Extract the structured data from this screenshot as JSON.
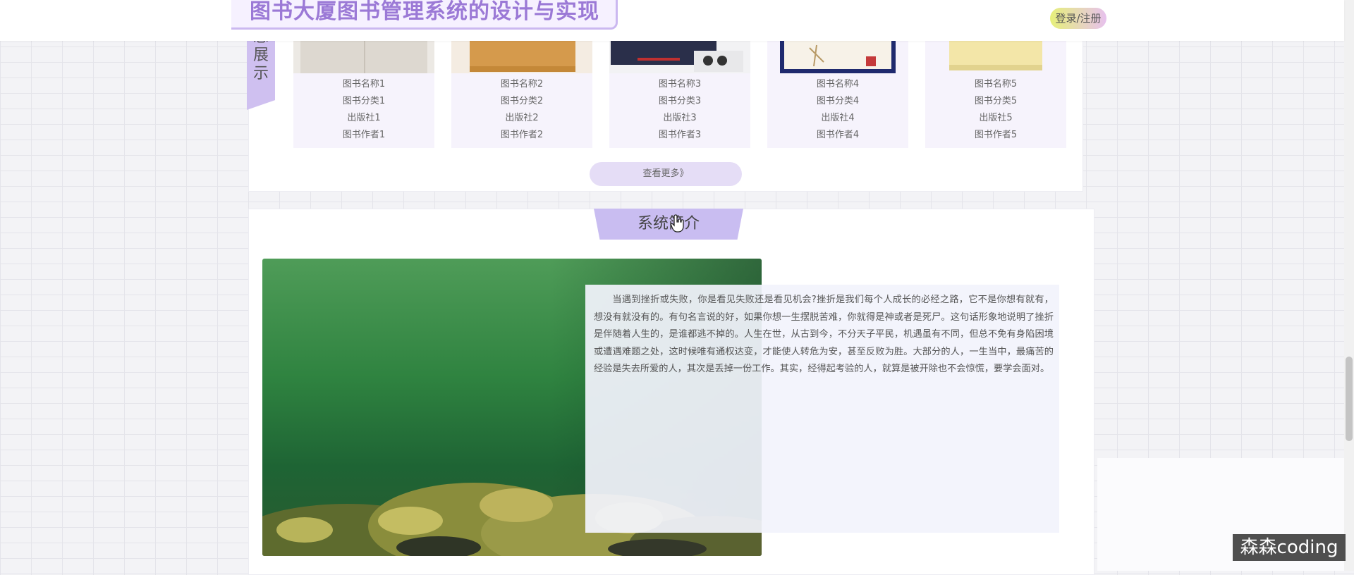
{
  "header": {
    "site_title": "图书大厦图书管理系统的设计与实现",
    "login_label": "登录/注册"
  },
  "books_section": {
    "side_label": [
      "息",
      "展",
      "示"
    ],
    "books": [
      {
        "name": "图书名称1",
        "category": "图书分类1",
        "publisher": "出版社1",
        "author": "图书作者1"
      },
      {
        "name": "图书名称2",
        "category": "图书分类2",
        "publisher": "出版社2",
        "author": "图书作者2"
      },
      {
        "name": "图书名称3",
        "category": "图书分类3",
        "publisher": "出版社3",
        "author": "图书作者3"
      },
      {
        "name": "图书名称4",
        "category": "图书分类4",
        "publisher": "出版社4",
        "author": "图书作者4"
      },
      {
        "name": "图书名称5",
        "category": "图书分类5",
        "publisher": "出版社5",
        "author": "图书作者5"
      }
    ],
    "more_label": "查看更多》"
  },
  "intro_section": {
    "title": "系统简介",
    "text": "当遇到挫折或失败，你是看见失败还是看见机会?挫折是我们每个人成长的必经之路，它不是你想有就有，想没有就没有的。有句名言说的好，如果你想一生摆脱苦难，你就得是神或者是死尸。这句话形象地说明了挫折是伴随着人生的，是谁都逃不掉的。人生在世，从古到今，不分天子平民，机遇虽有不同，但总不免有身陷困境或遭遇难题之处，这时候唯有通权达变，才能使人转危为安，甚至反败为胜。大部分的人，一生当中，最痛苦的经验是失去所爱的人，其次是丢掉一份工作。其实，经得起考验的人，就算是被开除也不会惊慌，要学会面对。"
  },
  "watermark": "森森coding",
  "colors": {
    "accent": "#9b79d6",
    "tab_purple": "#c9bdf1",
    "card_bg": "#f6f3fc"
  }
}
